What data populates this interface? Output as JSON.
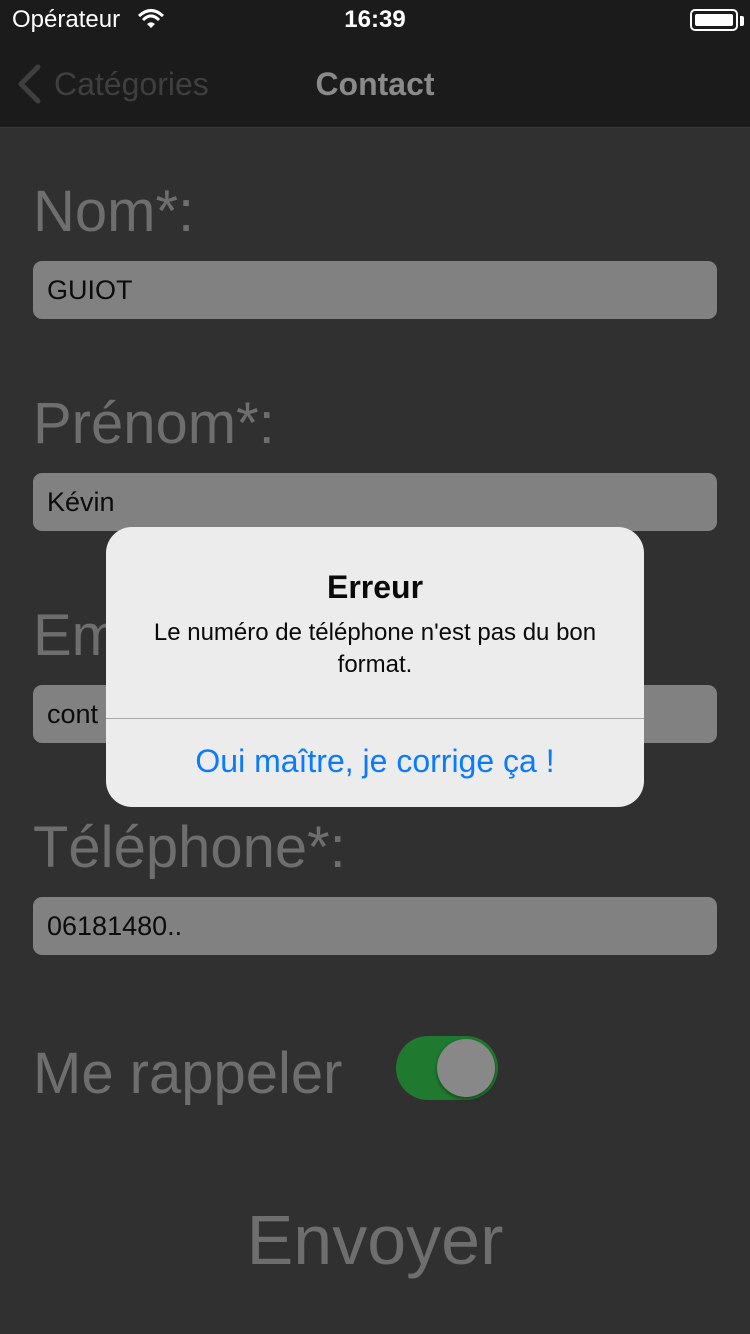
{
  "status_bar": {
    "carrier": "Opérateur",
    "time": "16:39"
  },
  "nav": {
    "back_label": "Catégories",
    "title": "Contact"
  },
  "form": {
    "nom": {
      "label": "Nom*:",
      "value": "GUIOT"
    },
    "prenom": {
      "label": "Prénom*:",
      "value": "Kévin"
    },
    "email": {
      "label": "Em",
      "value": "cont"
    },
    "telephone": {
      "label": "Téléphone*:",
      "value": "06181480.."
    },
    "rappel": {
      "label": "Me rappeler",
      "on": true
    },
    "submit_label": "Envoyer"
  },
  "alert": {
    "title": "Erreur",
    "message": "Le numéro de téléphone n'est pas du bon format.",
    "action_label": "Oui maître, je corrige ça !"
  },
  "colors": {
    "accent": "#0a7aff",
    "toggle_on": "#1f7a2f"
  }
}
